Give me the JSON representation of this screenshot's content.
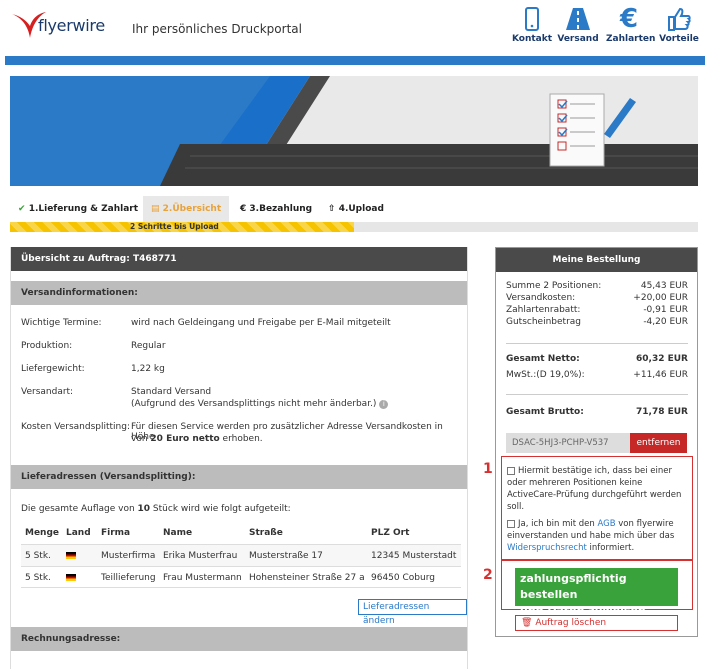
{
  "header": {
    "logo_text": "flyerwire",
    "tagline": "Ihr persönliches Druckportal",
    "nav": [
      {
        "label": "Kontakt",
        "icon": "phone-icon"
      },
      {
        "label": "Versand",
        "icon": "road-icon"
      },
      {
        "label": "Zahlarten",
        "icon": "euro-icon"
      },
      {
        "label": "Vorteile",
        "icon": "thumbs-up-icon"
      }
    ]
  },
  "steps": [
    {
      "label": "1.Lieferung & Zahlart",
      "icon": "check-icon"
    },
    {
      "label": "2.Übersicht",
      "icon": "list-icon"
    },
    {
      "label": "3.Bezahlung",
      "icon": "euro-icon"
    },
    {
      "label": "4.Upload",
      "icon": "upload-icon"
    }
  ],
  "progress": {
    "text": "2 Schritte bis Upload",
    "value": 0.5
  },
  "overview": {
    "title": "Übersicht zu Auftrag: T468771",
    "shipping_title": "Versandinformationen:",
    "rows": [
      {
        "label": "Wichtige Termine:",
        "value": "wird nach Geldeingang und Freigabe per E-Mail mitgeteilt"
      },
      {
        "label": "Produktion:",
        "value": "Regular"
      },
      {
        "label": "Liefergewicht:",
        "value": "1,22 kg"
      },
      {
        "label": "Versandart:",
        "value": "Standard Versand",
        "value2": "(Aufgrund des Versandsplittings nicht mehr änderbar.)"
      },
      {
        "label": "Kosten Versandsplitting:",
        "value": "Für diesen Service werden pro zusätzlicher Adresse Versandkosten in Höhe",
        "value2a": "von ",
        "value2b": "20 Euro netto",
        "value2c": " erhoben."
      }
    ],
    "addresses_title": "Lieferadressen (Versandsplitting):",
    "addresses_intro_a": "Die gesamte Auflage von ",
    "addresses_intro_b": "10",
    "addresses_intro_c": " Stück wird wie folgt aufgeteilt:",
    "table_headers": [
      "Menge",
      "Land",
      "Firma",
      "Name",
      "Straße",
      "PLZ Ort"
    ],
    "table_rows": [
      [
        "5 Stk.",
        "",
        "Musterfirma",
        "Erika Musterfrau",
        "Musterstraße 17",
        "12345 Musterstadt"
      ],
      [
        "5 Stk.",
        "",
        "Teillieferung",
        "Frau Mustermann",
        "Hohensteiner Straße 27 a",
        "96450 Coburg"
      ]
    ],
    "change_addresses": "Lieferadressen ändern",
    "billing_title": "Rechnungsadresse:"
  },
  "order": {
    "title": "Meine Bestellung",
    "lines": [
      {
        "label": "Summe 2 Positionen:",
        "value": "45,43 EUR"
      },
      {
        "label": "Versandkosten:",
        "value": "+20,00 EUR"
      },
      {
        "label": "Zahlartenrabatt:",
        "value": "-0,91 EUR"
      },
      {
        "label": "Gutscheinbetrag",
        "value": "-4,20 EUR"
      }
    ],
    "net_label": "Gesamt Netto:",
    "net_value": "60,32 EUR",
    "vat_label": "MwSt.:(D 19,0%):",
    "vat_value": "+11,46 EUR",
    "gross_label": "Gesamt Brutto:",
    "gross_value": "71,78 EUR",
    "voucher_code": "DSAC-5HJ3-PCHP-V537",
    "remove_label": "entfernen",
    "marker1": "1",
    "marker2": "2",
    "check1": "Hiermit bestätige ich, dass bei einer oder mehreren Positionen keine ActiveCare-Prüfung durchgeführt werden soll.",
    "check2_a": "Ja, ich bin mit den ",
    "check2_link1": "AGB",
    "check2_b": " von flyerwire einverstanden und habe mich über das ",
    "check2_link2": "Widerspruchsrecht",
    "check2_c": " informiert.",
    "submit_line1": "zahlungspflichtig bestellen",
    "submit_line2": "und Daten zuweisen",
    "cancel_label": "Auftrag löschen"
  },
  "colors": {
    "accent": "#2a7ac8",
    "dark": "#4a4a4a",
    "green": "#3aa23a",
    "red": "#d63030",
    "yellow": "#f5c300"
  }
}
